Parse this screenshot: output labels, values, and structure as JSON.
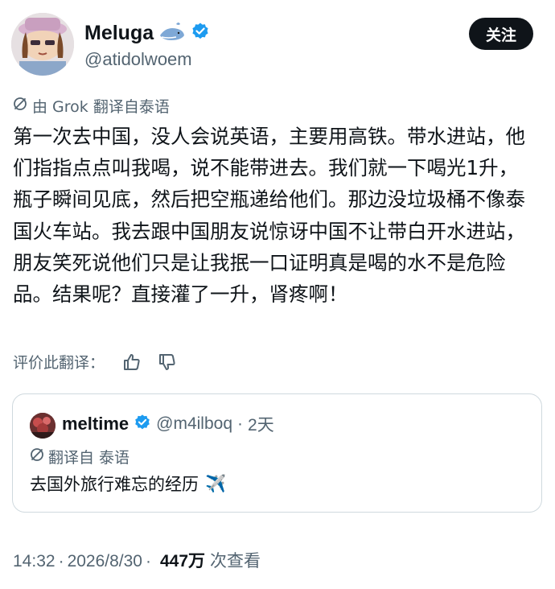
{
  "author": {
    "display_name": "Meluga",
    "handle": "@atidolwoem"
  },
  "follow_button": {
    "label": "关注"
  },
  "translation_note": "由 Grok 翻译自泰语",
  "post_text": "第一次去中国，没人会说英语，主要用高铁。带水进站，他们指指点点叫我喝，说不能带进去。我们就一下喝光1升，瓶子瞬间见底，然后把空瓶递给他们。那边没垃圾桶不像泰国火车站。我去跟中国朋友说惊讶中国不让带白开水进站，朋友笑死说他们只是让我抿一口证明真是喝的水不是危险品。结果呢？直接灌了一升，肾疼啊！",
  "rate_translation": {
    "label": "评价此翻译："
  },
  "quote": {
    "display_name": "meltime",
    "handle": "@m4ilboq",
    "separator": "·",
    "time": "2天",
    "translate_label": "翻译自 泰语",
    "text": "去国外旅行难忘的经历",
    "emoji": "✈️"
  },
  "meta": {
    "time": "14:32",
    "sep1": "·",
    "date": "2026/8/30",
    "sep2": "·",
    "views": "447万",
    "views_label": "次查看"
  },
  "colors": {
    "verified": "#1d9bf0",
    "secondary_text": "#536471",
    "primary_text": "#0f1419",
    "follow_bg": "#0f1419"
  }
}
